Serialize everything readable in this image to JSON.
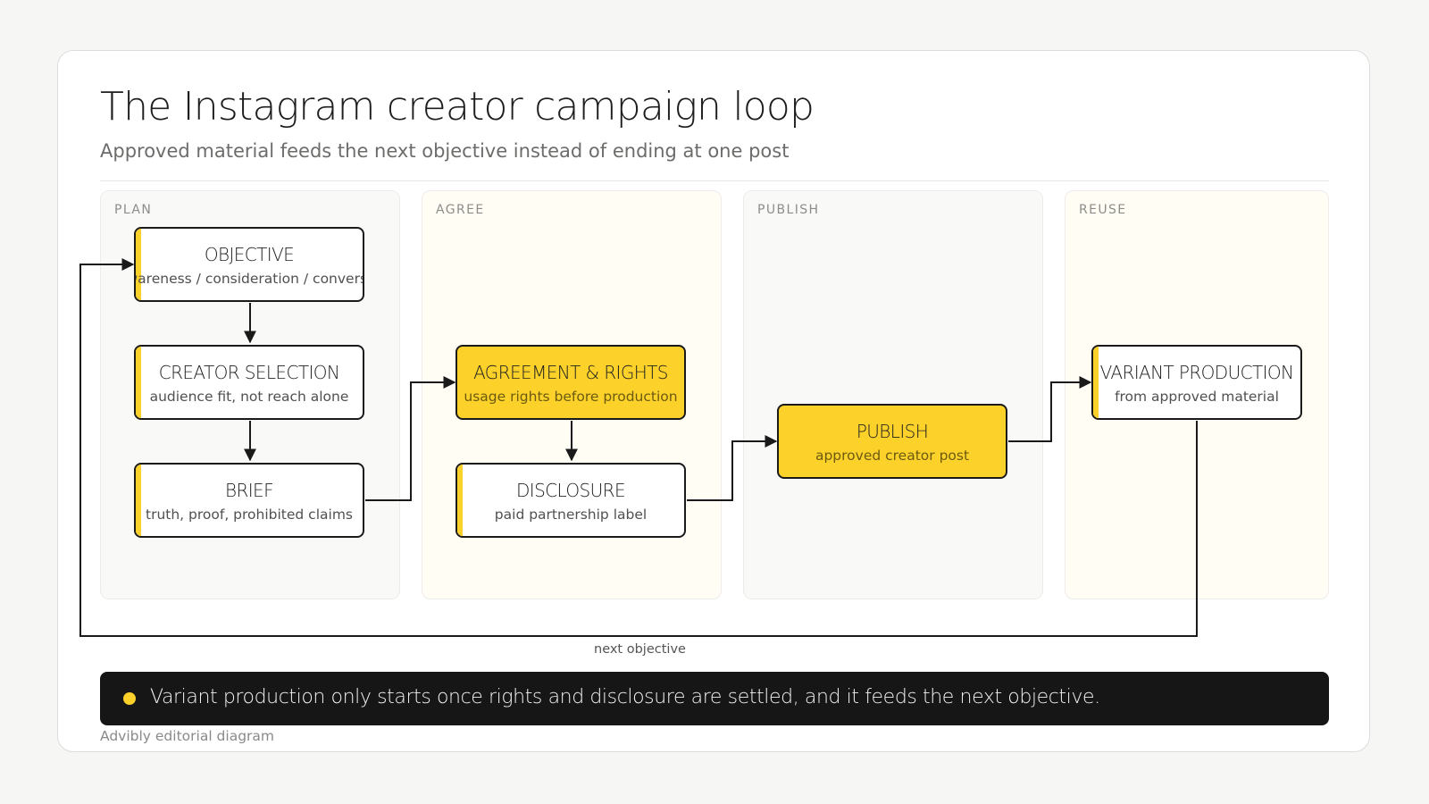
{
  "header": {
    "title": "The Instagram creator campaign loop",
    "subtitle": "Approved material feeds the next objective instead of ending at one post"
  },
  "lanes": [
    {
      "label": "PLAN"
    },
    {
      "label": "AGREE"
    },
    {
      "label": "PUBLISH"
    },
    {
      "label": "REUSE"
    }
  ],
  "nodes": {
    "objective": {
      "title": "OBJECTIVE",
      "subtitle": "awareness / consideration / conversion"
    },
    "creator_selection": {
      "title": "CREATOR SELECTION",
      "subtitle": "audience fit, not reach alone"
    },
    "brief": {
      "title": "BRIEF",
      "subtitle": "truth, proof, prohibited claims"
    },
    "agreement": {
      "title": "AGREEMENT & RIGHTS",
      "subtitle": "usage rights before production"
    },
    "disclosure": {
      "title": "DISCLOSURE",
      "subtitle": "paid partnership label"
    },
    "publish": {
      "title": "PUBLISH",
      "subtitle": "approved creator post"
    },
    "variant": {
      "title": "VARIANT PRODUCTION",
      "subtitle": "from approved material"
    }
  },
  "loop": {
    "label": "next objective"
  },
  "callout": {
    "text": "Variant production only starts once rights and disclosure are settled, and it feeds the next objective."
  },
  "footer": {
    "text": "Advibly editorial diagram"
  },
  "colors": {
    "accent": "#fcd22a",
    "ink": "#1a1a1a",
    "callout_bg": "#161616"
  }
}
